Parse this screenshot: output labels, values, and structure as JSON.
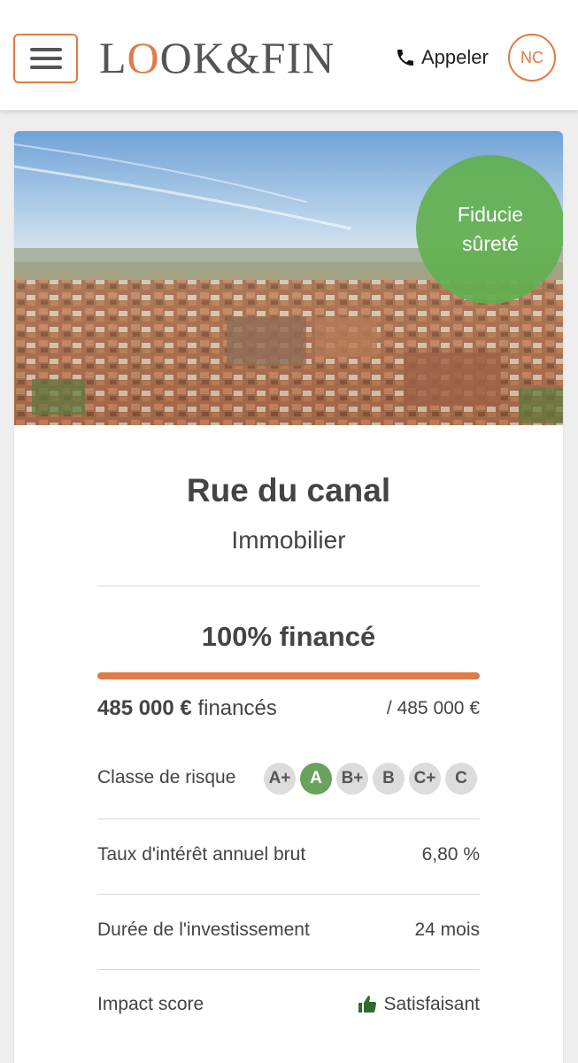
{
  "header": {
    "menu_label": "Menu",
    "logo": "LOOK&FIN",
    "call_label": "Appeler",
    "avatar_initials": "NC",
    "accent_color": "#e07a46"
  },
  "project": {
    "badge": "Fiducie sûreté",
    "title": "Rue du canal",
    "category": "Immobilier",
    "funded_title": "100% financé",
    "progress_fraction": 1.0,
    "amount_value": "485 000 €",
    "amount_suffix": " financés",
    "total": "/ 485 000 €",
    "risk": {
      "label": "Classe de risque",
      "classes": [
        "A+",
        "A",
        "B+",
        "B",
        "C+",
        "C"
      ],
      "selected": "A"
    },
    "rows": [
      {
        "label": "Taux d'intérêt annuel brut",
        "value": "6,80 %"
      },
      {
        "label": "Durée de l'investissement",
        "value": "24 mois"
      }
    ],
    "impact": {
      "label": "Impact score",
      "icon": "thumbs-up-icon",
      "value": "Satisfaisant"
    }
  }
}
